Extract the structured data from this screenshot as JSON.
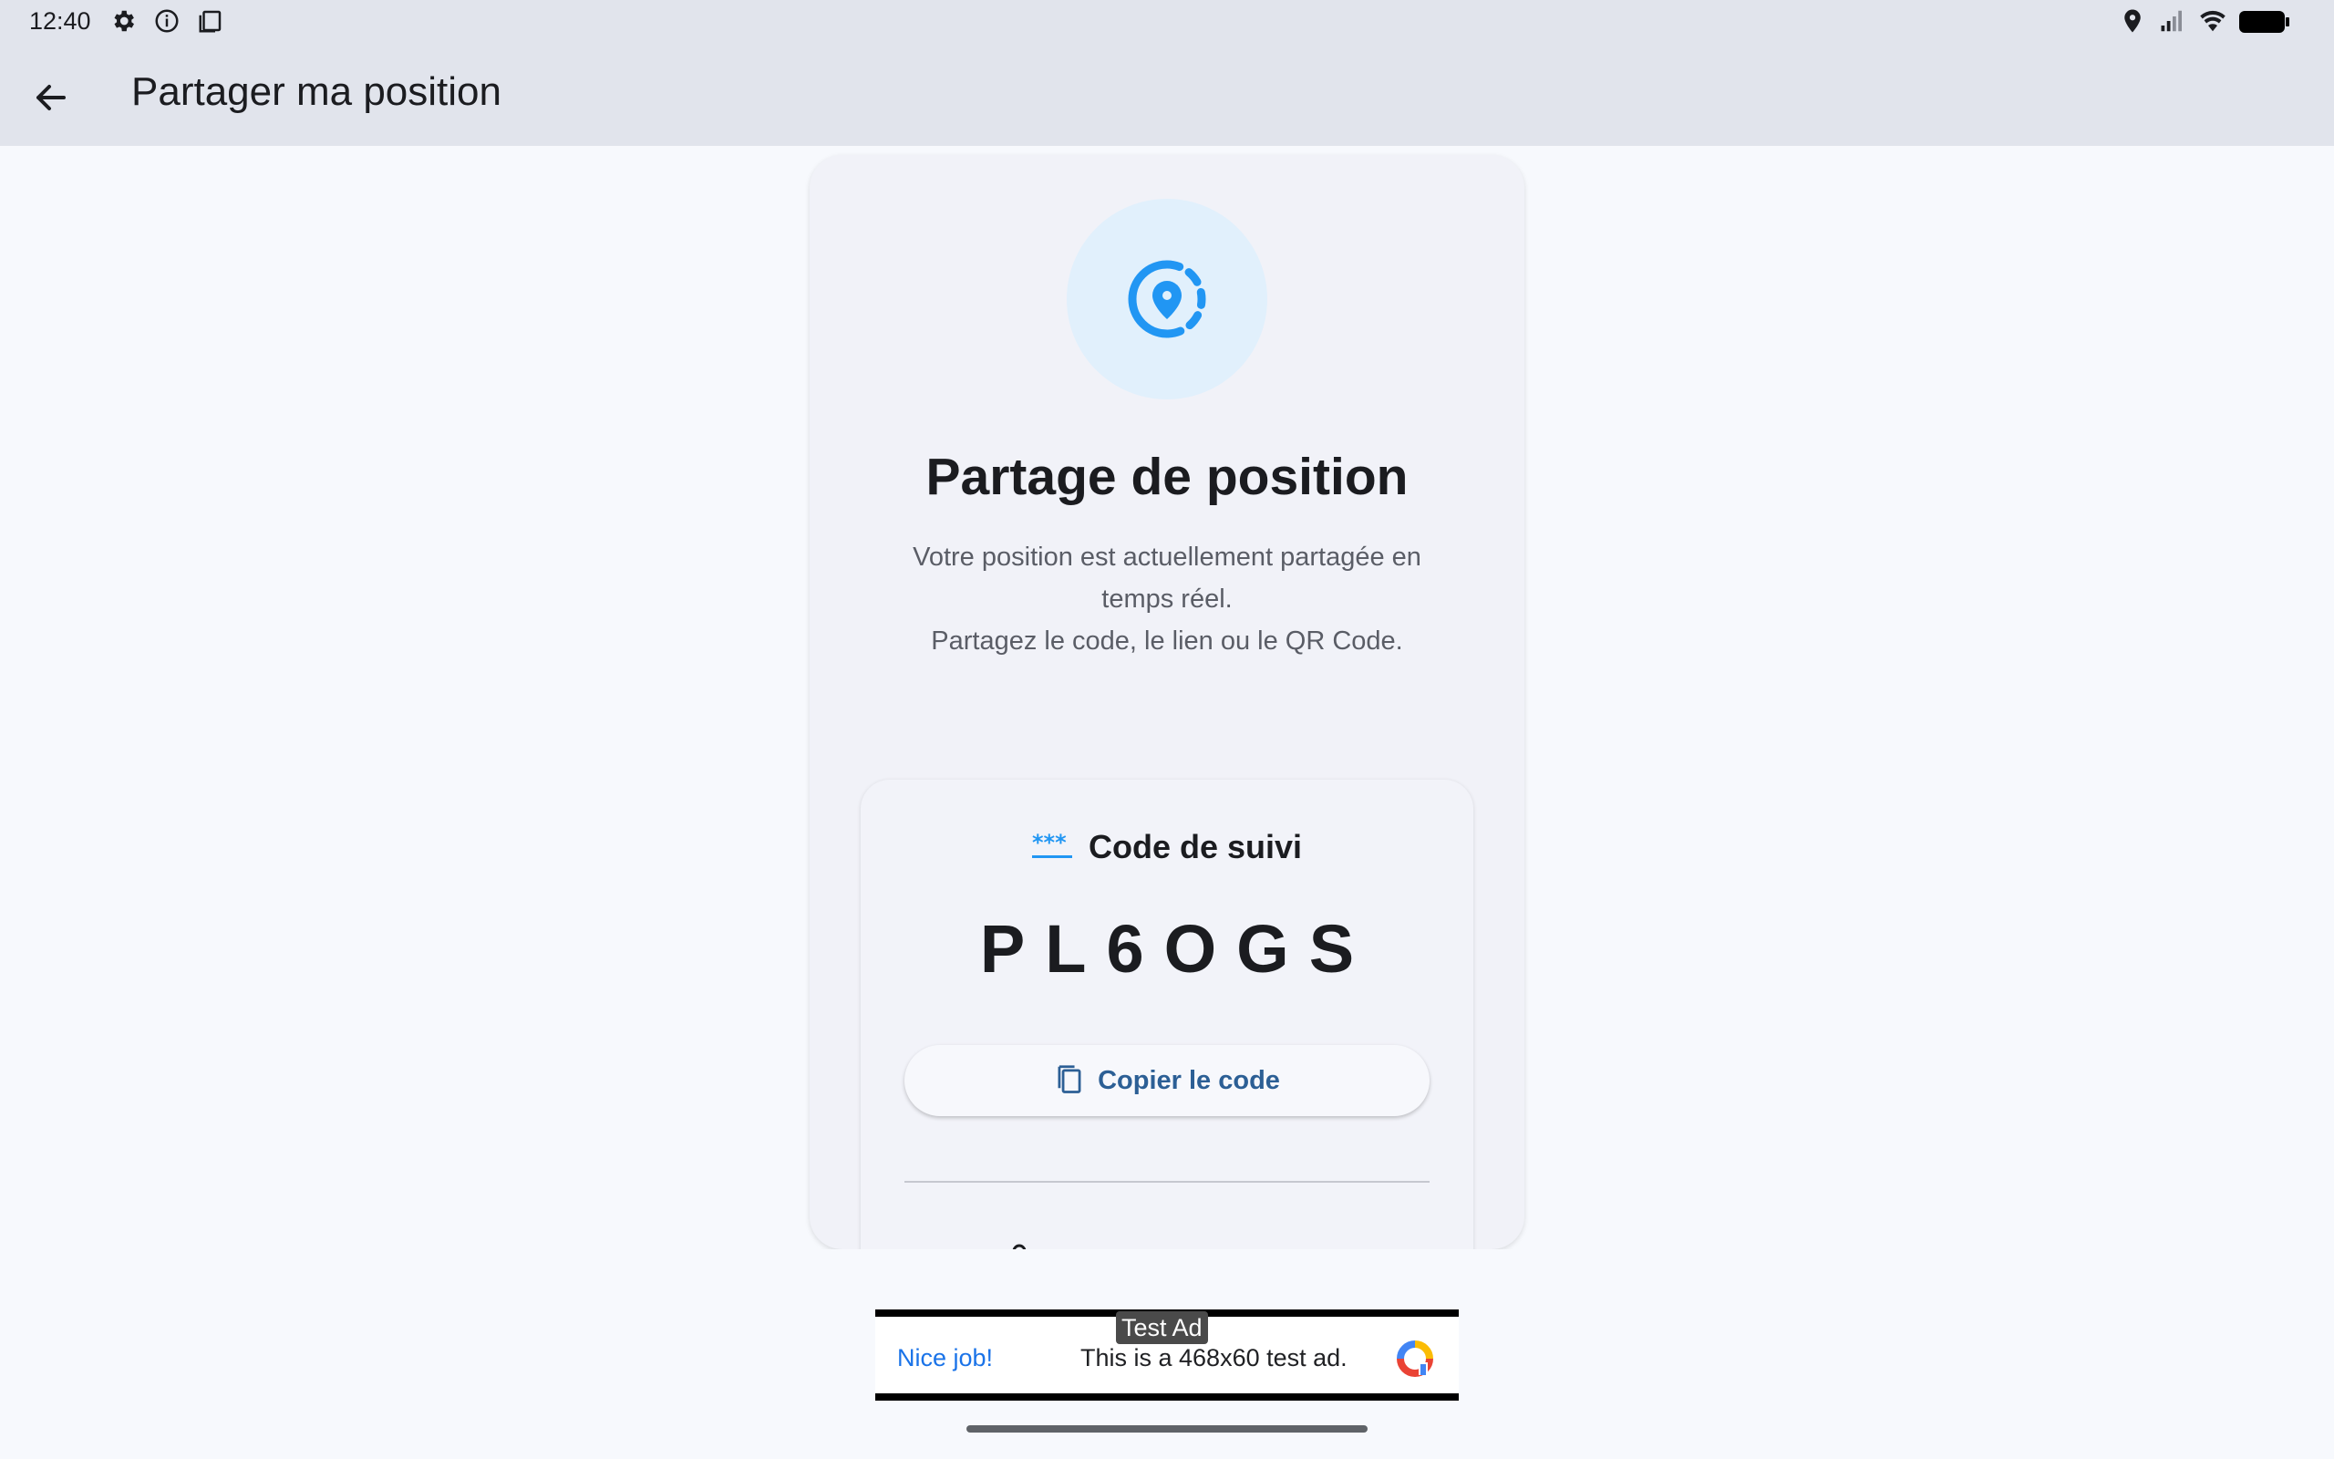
{
  "status_bar": {
    "time": "12:40",
    "left_icons": [
      "settings-gear-icon",
      "info-icon",
      "clipboard-icon"
    ],
    "right_icons": [
      "location-pin-icon",
      "signal-icon",
      "wifi-icon",
      "battery-icon"
    ]
  },
  "app_bar": {
    "title": "Partager ma position",
    "back_icon": "arrow-back-icon"
  },
  "main": {
    "hero_icon": "location-sharing-icon",
    "heading": "Partage de position",
    "description_line1": "Votre position est actuellement partagée en",
    "description_line2": "temps réel.",
    "description_line3": "Partagez le code, le lien ou le QR Code.",
    "code_section": {
      "icon": "password-asterisks-icon",
      "label": "Code de suivi",
      "code": "PL6OGS",
      "copy_button_label": "Copier le code",
      "copy_icon": "copy-icon"
    }
  },
  "ad": {
    "tag": "Test Ad",
    "left_text": "Nice job!",
    "text": "This is a 468x60 test ad."
  },
  "colors": {
    "accent_blue": "#2196f3",
    "button_text": "#2c5f95",
    "app_bar_bg": "#e1e4ec"
  }
}
